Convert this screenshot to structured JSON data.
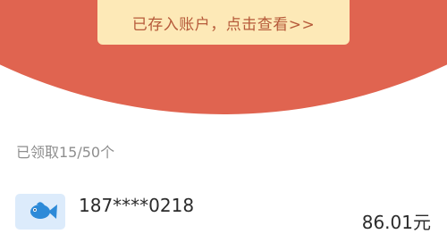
{
  "banner": {
    "button_label": "已存入账户，点击查看>>",
    "color": "#e06450",
    "button_color": "#fde9b7"
  },
  "summary": {
    "received_text": "已领取15/50个"
  },
  "records": [
    {
      "avatar_icon": "fish-icon",
      "phone": "187****0218",
      "amount": "86.01元"
    }
  ]
}
